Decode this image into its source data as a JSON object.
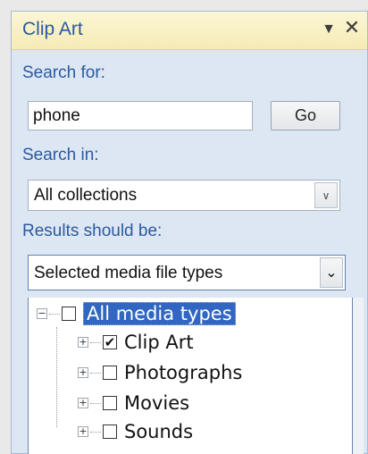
{
  "panel": {
    "title": "Clip Art",
    "menu_icon": "▼",
    "close_icon": "✕"
  },
  "search": {
    "label": "Search for:",
    "value": "phone",
    "go_label": "Go"
  },
  "search_in": {
    "label": "Search in:",
    "selected": "All collections"
  },
  "results": {
    "label": "Results should be:",
    "selected": "Selected media file types"
  },
  "media_tree": {
    "root": {
      "label": "All media types",
      "checked": false,
      "expander": "−"
    },
    "items": [
      {
        "label": "Clip Art",
        "checked": true,
        "expander": "+"
      },
      {
        "label": "Photographs",
        "checked": false,
        "expander": "+"
      },
      {
        "label": "Movies",
        "checked": false,
        "expander": "+"
      },
      {
        "label": "Sounds",
        "checked": false,
        "expander": "+"
      }
    ]
  },
  "icons": {
    "dropdown": "chevron-down-icon",
    "check": "✔"
  }
}
